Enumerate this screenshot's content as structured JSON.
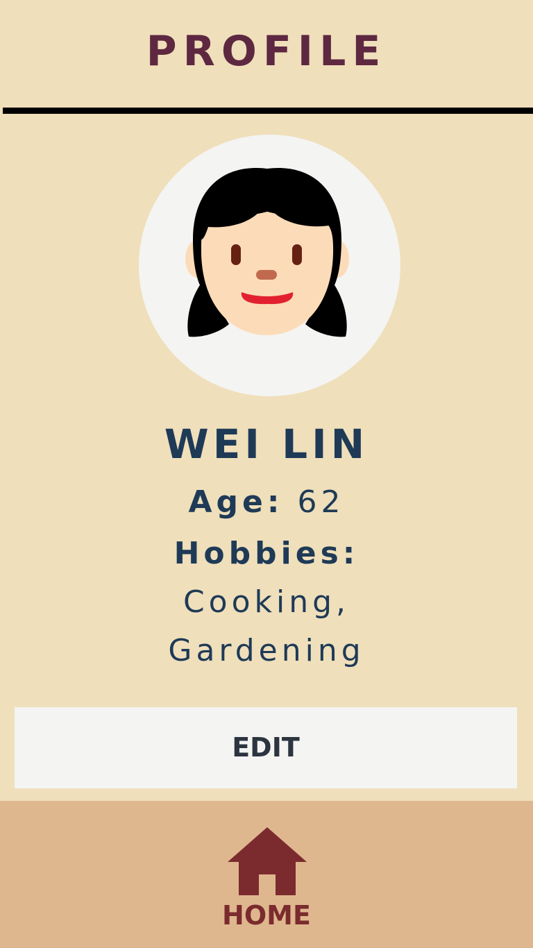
{
  "header": {
    "title": "PROFILE"
  },
  "profile": {
    "avatar_icon": "woman-face-icon",
    "name": "WEI LIN",
    "age_label": "Age:",
    "age_value": "62",
    "hobbies_label": "Hobbies:",
    "hobbies_line1": "Cooking,",
    "hobbies_line2": "Gardening"
  },
  "actions": {
    "edit_label": "EDIT"
  },
  "nav": {
    "home_icon": "home-icon",
    "home_label": "HOME"
  },
  "colors": {
    "background": "#efdfbb",
    "title": "#5e2841",
    "text": "#1e3a56",
    "button_bg": "#f4f4f2",
    "bottom_bar": "#dfb78f",
    "nav_accent": "#7b2b2e"
  }
}
